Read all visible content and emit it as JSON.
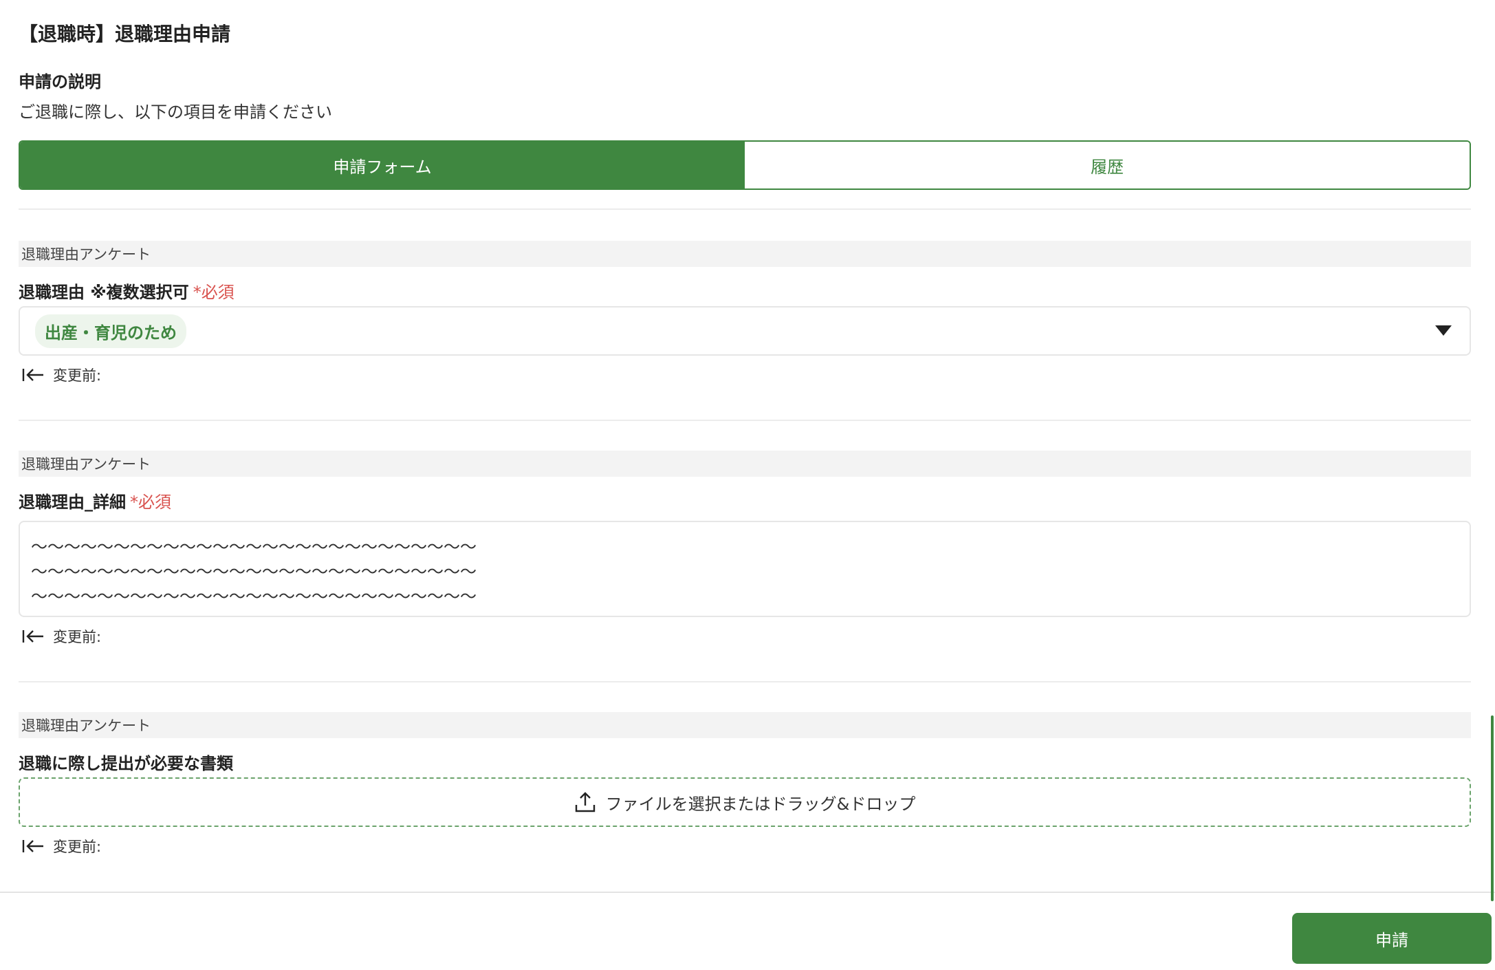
{
  "page": {
    "title": "【退職時】退職理由申請",
    "description_label": "申請の説明",
    "description_text": "ご退職に際し、以下の項目を申請ください"
  },
  "tabs": [
    {
      "label": "申請フォーム",
      "active": true
    },
    {
      "label": "履歴",
      "active": false
    }
  ],
  "fields": [
    {
      "section": "退職理由アンケート",
      "label": "退職理由 ※複数選択可",
      "required_text": "*必須",
      "selected_value": "出産・育児のため",
      "prev_label": "変更前:"
    },
    {
      "section": "退職理由アンケート",
      "label": "退職理由_詳細",
      "required_text": "*必須",
      "value": "〜〜〜〜〜〜〜〜〜〜〜〜〜〜〜〜〜〜〜〜〜〜〜〜〜〜〜\n〜〜〜〜〜〜〜〜〜〜〜〜〜〜〜〜〜〜〜〜〜〜〜〜〜〜〜\n〜〜〜〜〜〜〜〜〜〜〜〜〜〜〜〜〜〜〜〜〜〜〜〜〜〜〜",
      "prev_label": "変更前:"
    },
    {
      "section": "退職理由アンケート",
      "label": "退職に際し提出が必要な書類",
      "upload_text": "ファイルを選択またはドラッグ&ドロップ",
      "prev_label": "変更前:"
    }
  ],
  "actions": {
    "submit_label": "申請"
  },
  "colors": {
    "accent": "#3f8740",
    "required": "#d9534f",
    "chip_bg": "#edf5ec",
    "section_bg": "#f3f3f3"
  },
  "icons": {
    "back_to_start": "arrow-to-line-left-icon",
    "dropdown": "caret-down-icon",
    "upload": "upload-icon"
  }
}
